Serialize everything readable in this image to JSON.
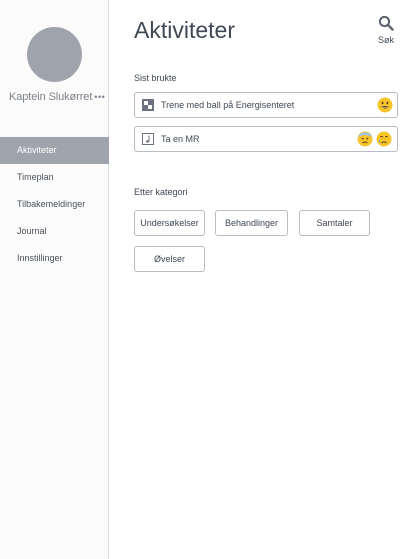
{
  "profile": {
    "name": "Kaptein Slukørret",
    "more": "•••"
  },
  "nav": {
    "items": [
      {
        "label": "Aktiviteter",
        "active": true
      },
      {
        "label": "Timeplan",
        "active": false
      },
      {
        "label": "Tilbakemeldinger",
        "active": false
      },
      {
        "label": "Journal",
        "active": false
      },
      {
        "label": "Innstillinger",
        "active": false
      }
    ]
  },
  "main": {
    "title": "Aktiviteter",
    "search_label": "Søk",
    "recent": {
      "label": "Sist brukte",
      "items": [
        {
          "text": "Trene med ball på Energisenteret",
          "icon": "checker-icon",
          "moods": [
            "grinning-face-emoji"
          ]
        },
        {
          "text": "Ta en MR",
          "icon": "music-note-icon",
          "moods": [
            "anxious-face-emoji",
            "crying-face-emoji"
          ]
        }
      ]
    },
    "categories": {
      "label": "Etter kategori",
      "buttons": [
        "Undersøkelser",
        "Behandlinger",
        "Samtaler",
        "Øvelser"
      ]
    }
  },
  "colors": {
    "sidebar_bg": "#fbfbfb",
    "active_nav_bg": "#9fa3ab",
    "text": "#3f4855",
    "border": "#b9bdc3",
    "emoji_yellow": "#f7c52b"
  }
}
